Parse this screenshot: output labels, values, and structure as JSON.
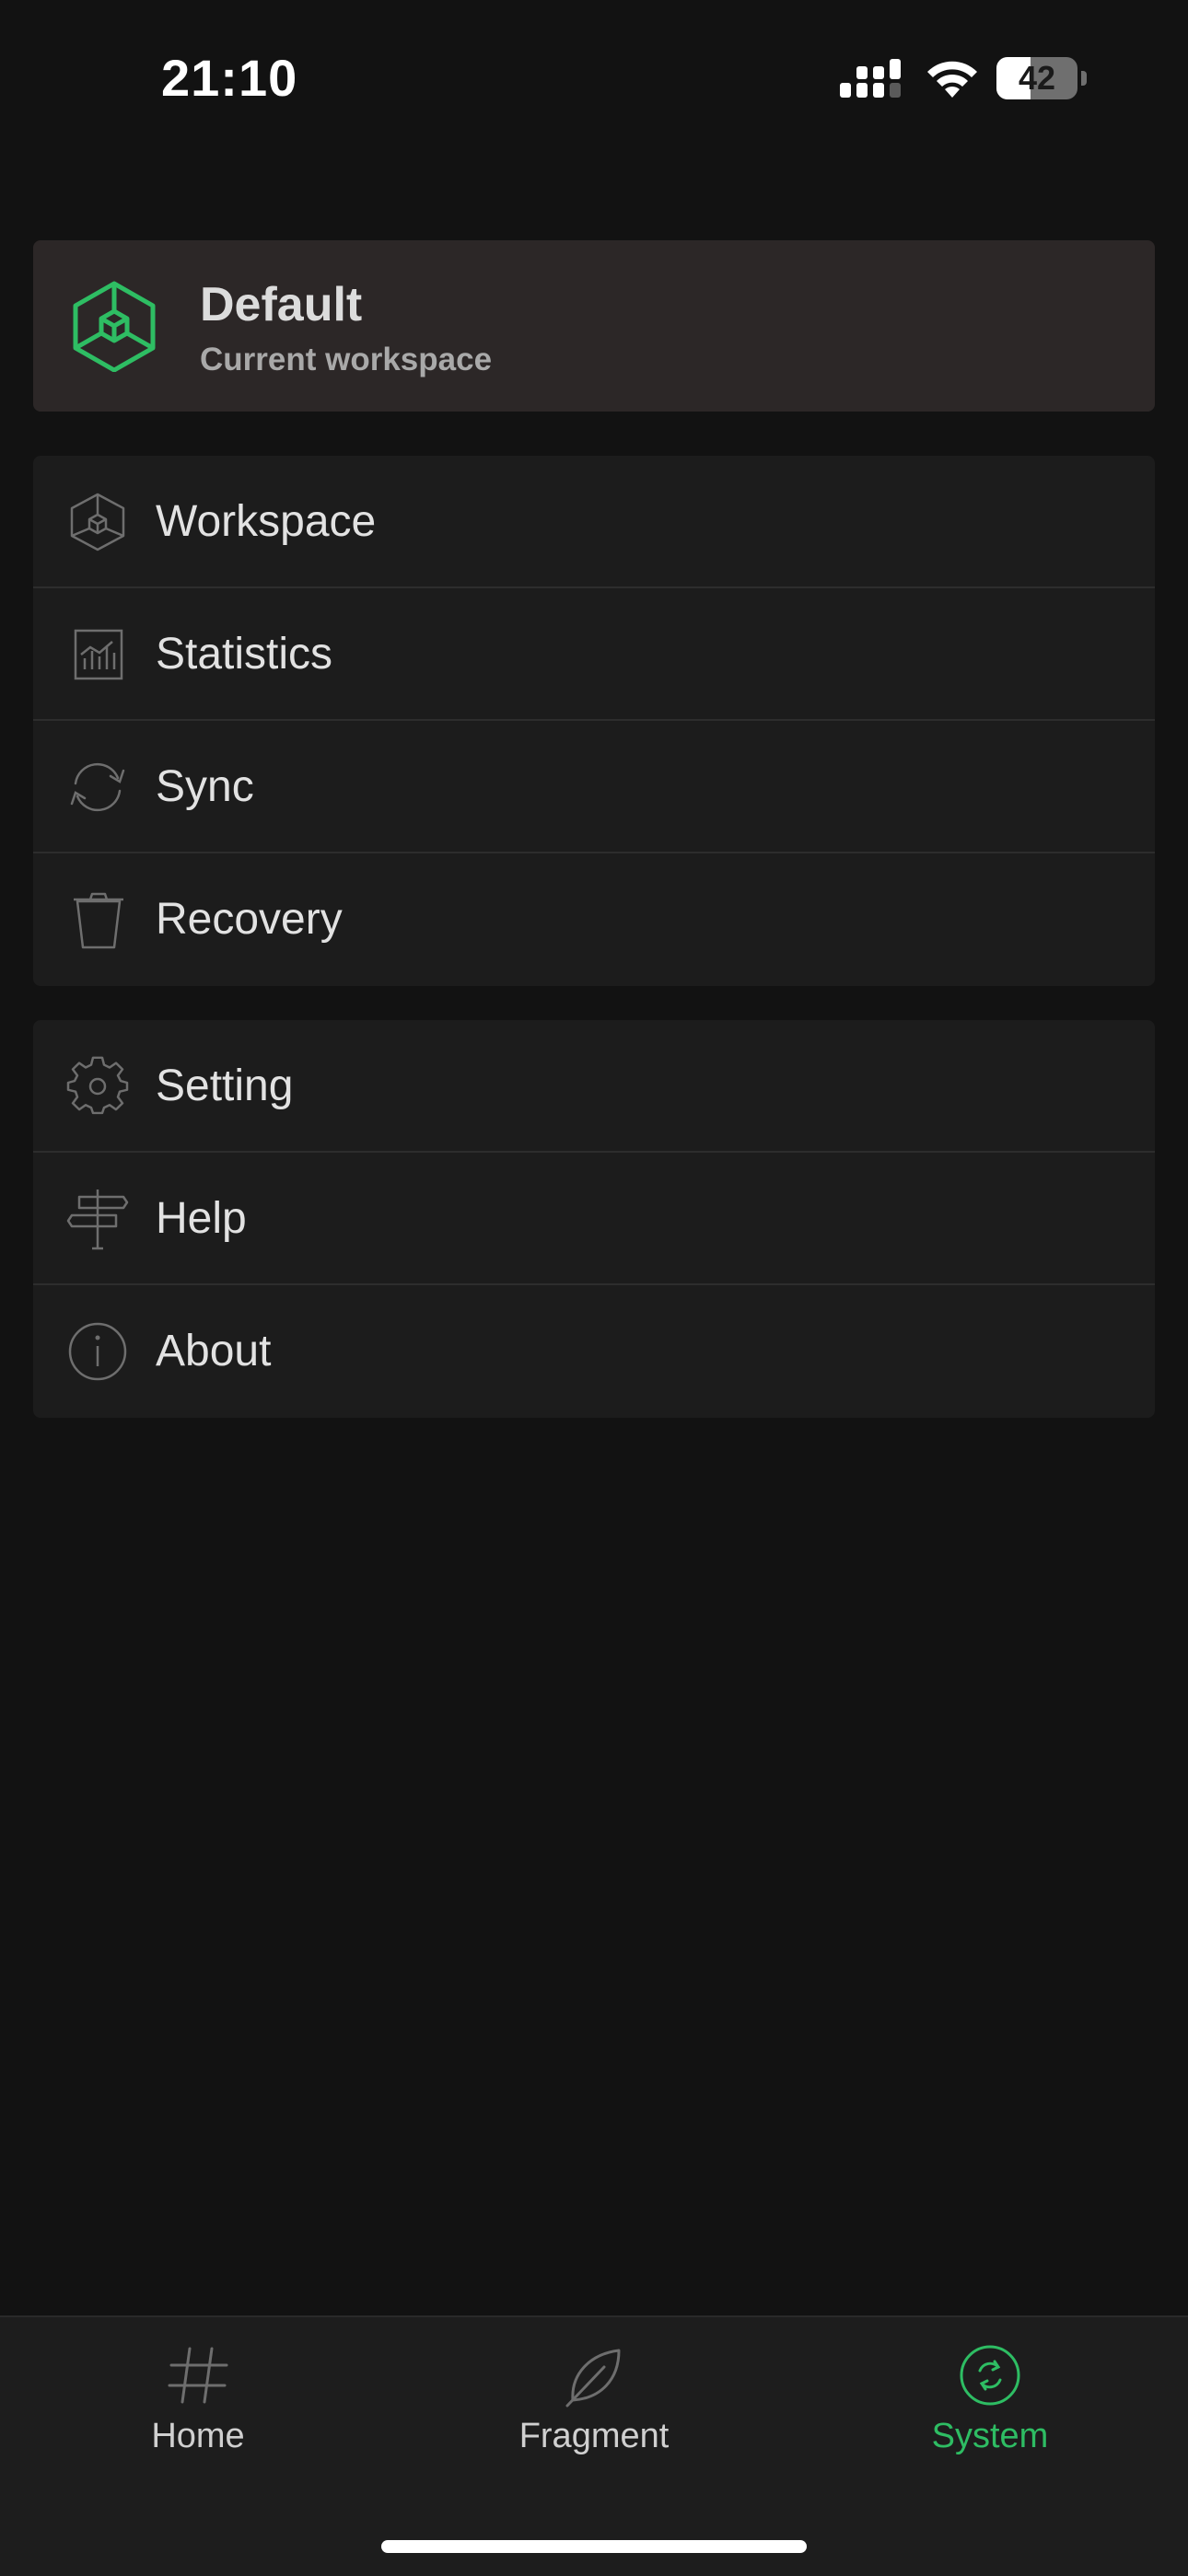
{
  "status_bar": {
    "time": "21:10",
    "battery_percent": 42,
    "battery_text": "42",
    "icons": [
      "signal-icon",
      "wifi-icon",
      "battery-icon"
    ]
  },
  "workspace_card": {
    "name": "Default",
    "subtitle": "Current workspace",
    "icon": "workspace-cube-icon",
    "accent_color": "#2ebd63"
  },
  "menu_groups": [
    {
      "items": [
        {
          "label": "Workspace",
          "icon": "cube-icon"
        },
        {
          "label": "Statistics",
          "icon": "chart-icon"
        },
        {
          "label": "Sync",
          "icon": "sync-icon"
        },
        {
          "label": "Recovery",
          "icon": "trash-icon"
        }
      ]
    },
    {
      "items": [
        {
          "label": "Setting",
          "icon": "gear-icon"
        },
        {
          "label": "Help",
          "icon": "signpost-icon"
        },
        {
          "label": "About",
          "icon": "info-icon"
        }
      ]
    }
  ],
  "tab_bar": {
    "tabs": [
      {
        "label": "Home",
        "icon": "hash-icon",
        "active": false
      },
      {
        "label": "Fragment",
        "icon": "leaf-icon",
        "active": false
      },
      {
        "label": "System",
        "icon": "system-circle-icon",
        "active": true
      }
    ],
    "active_color": "#2ebd63"
  },
  "colors": {
    "background": "#121212",
    "card": "#1c1c1c",
    "workspace_card": "#2c2727",
    "icon_gray": "#6e6e6e"
  }
}
